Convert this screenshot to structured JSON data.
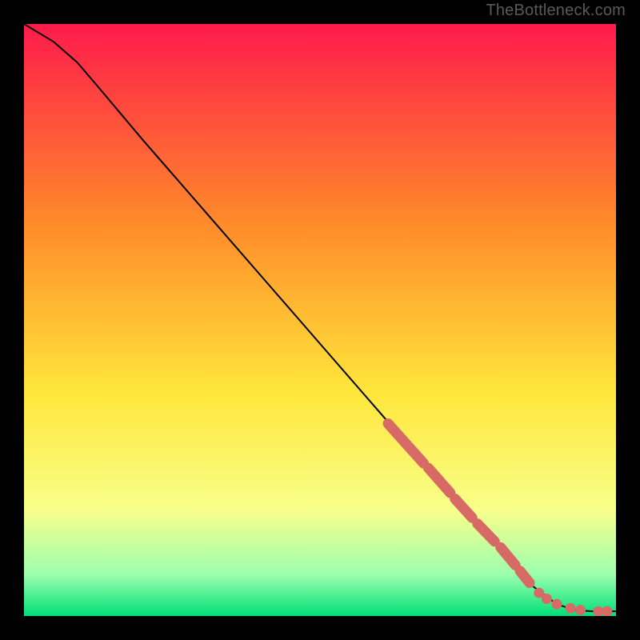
{
  "attribution": "TheBottleneck.com",
  "colors": {
    "gradient_top": "#ff1b4b",
    "gradient_mid1": "#ff8c2a",
    "gradient_mid2": "#ffe63a",
    "gradient_mid3": "#f8ff8a",
    "gradient_mid4": "#9cffae",
    "gradient_bottom": "#00e07a",
    "curve": "#000000",
    "marker_fill": "#d86a66",
    "marker_stroke": "#b94e4a",
    "background": "#000000"
  },
  "chart_data": {
    "type": "line",
    "title": "",
    "xlabel": "",
    "ylabel": "",
    "xlim": [
      0,
      100
    ],
    "ylim": [
      0,
      100
    ],
    "grid": false,
    "legend": false,
    "curve": [
      {
        "x": 0,
        "y": 100
      },
      {
        "x": 5,
        "y": 97
      },
      {
        "x": 9,
        "y": 93.5
      },
      {
        "x": 12,
        "y": 90
      },
      {
        "x": 20,
        "y": 80.5
      },
      {
        "x": 30,
        "y": 69
      },
      {
        "x": 40,
        "y": 57.5
      },
      {
        "x": 50,
        "y": 46
      },
      {
        "x": 60,
        "y": 34.5
      },
      {
        "x": 70,
        "y": 23
      },
      {
        "x": 80,
        "y": 12
      },
      {
        "x": 86,
        "y": 5
      },
      {
        "x": 90,
        "y": 2
      },
      {
        "x": 93,
        "y": 1
      },
      {
        "x": 96,
        "y": 0.8
      },
      {
        "x": 100,
        "y": 0.8
      }
    ],
    "marker_segments": [
      {
        "x0": 61.5,
        "y0": 32.5,
        "x1": 67.5,
        "y1": 25.8
      },
      {
        "x0": 68.3,
        "y0": 25.0,
        "x1": 72.0,
        "y1": 20.8
      },
      {
        "x0": 72.8,
        "y0": 19.8,
        "x1": 75.7,
        "y1": 16.6
      },
      {
        "x0": 76.6,
        "y0": 15.6,
        "x1": 79.5,
        "y1": 12.6
      },
      {
        "x0": 80.5,
        "y0": 11.6,
        "x1": 83.0,
        "y1": 8.6
      },
      {
        "x0": 83.8,
        "y0": 7.6,
        "x1": 85.4,
        "y1": 5.6
      }
    ],
    "marker_points": [
      {
        "x": 87.0,
        "y": 3.9
      },
      {
        "x": 88.3,
        "y": 2.9
      },
      {
        "x": 90.0,
        "y": 2.0
      },
      {
        "x": 92.3,
        "y": 1.3
      },
      {
        "x": 94.0,
        "y": 1.0
      },
      {
        "x": 97.0,
        "y": 0.8
      },
      {
        "x": 98.5,
        "y": 0.8
      }
    ]
  }
}
